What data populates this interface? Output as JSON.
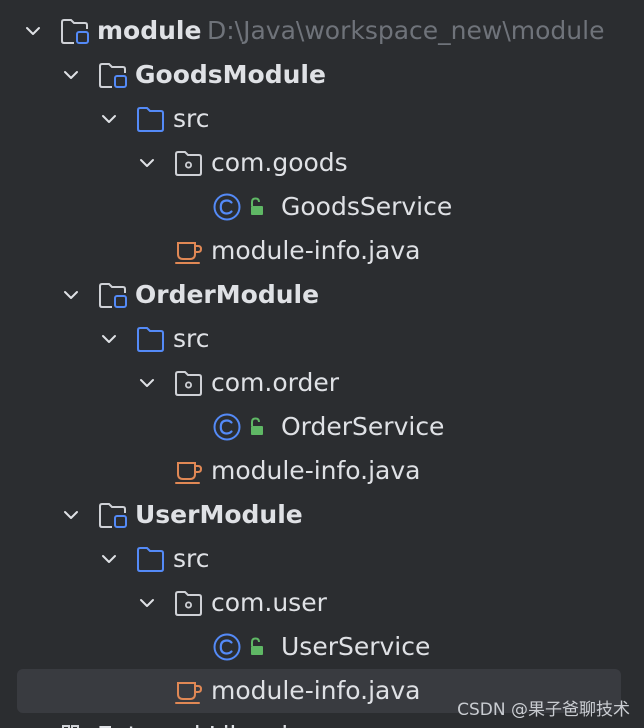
{
  "root": {
    "label": "module",
    "path": "D:\\Java\\workspace_new\\module"
  },
  "modules": [
    {
      "label": "GoodsModule",
      "src_label": "src",
      "package_label": "com.goods",
      "class_label": "GoodsService",
      "module_info_label": "module-info.java"
    },
    {
      "label": "OrderModule",
      "src_label": "src",
      "package_label": "com.order",
      "class_label": "OrderService",
      "module_info_label": "module-info.java"
    },
    {
      "label": "UserModule",
      "src_label": "src",
      "package_label": "com.user",
      "class_label": "UserService",
      "module_info_label": "module-info.java"
    }
  ],
  "next_item_label": "External Libraries",
  "watermark": "CSDN @果子爸聊技术",
  "colors": {
    "background": "#2b2d30",
    "selection": "#393b40",
    "text": "#dfe1e5",
    "path_text": "#6f737a",
    "folder_blue": "#548af7",
    "class_blue": "#548af7",
    "lock_green": "#5fb865",
    "java_orange": "#e08855"
  },
  "icons": {
    "chevron": "chevron-down-icon",
    "module": "module-folder-icon",
    "source": "source-folder-icon",
    "package": "package-icon",
    "class": "class-icon",
    "access": "lock-icon",
    "module_info": "java-cup-icon"
  }
}
